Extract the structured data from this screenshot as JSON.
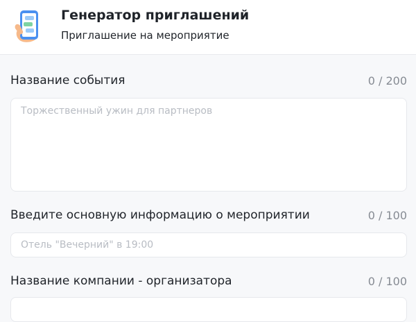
{
  "header": {
    "title": "Генератор приглашений",
    "subtitle": "Приглашение на мероприятие",
    "icon": "chat-phone-icon"
  },
  "fields": [
    {
      "label": "Название события",
      "counter": "0 / 200",
      "value": "",
      "placeholder": "Торжественный ужин для партнеров"
    },
    {
      "label": "Введите основную информацию о мероприятии",
      "counter": "0 / 100",
      "value": "",
      "placeholder": "Отель \"Вечерний\" в 19:00"
    },
    {
      "label": "Название компании - организатора",
      "counter": "0 / 100",
      "value": "",
      "placeholder": ""
    }
  ],
  "colors": {
    "background": "#f7f8fa",
    "text": "#1f2329",
    "muted": "#868b93",
    "placeholder": "#b8bcc3",
    "icon_accent": "#4a90f0"
  }
}
